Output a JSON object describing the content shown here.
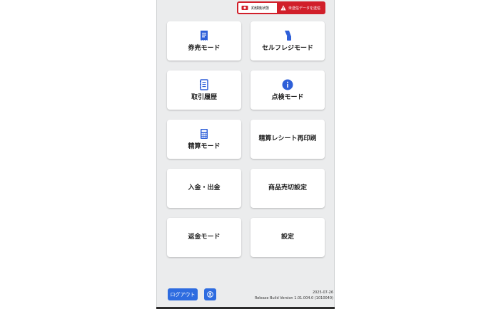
{
  "status": {
    "device_state_label": "釣銭機状態",
    "unsent_label": "未送信データを送信"
  },
  "tiles": [
    {
      "label": "券売モード",
      "icon": "ticket-icon"
    },
    {
      "label": "セルフレジモード",
      "icon": "self-register-icon"
    },
    {
      "label": "取引履歴",
      "icon": "history-icon"
    },
    {
      "label": "点検モード",
      "icon": "info-icon"
    },
    {
      "label": "精算モード",
      "icon": "calculator-icon"
    },
    {
      "label": "精算レシート再印刷",
      "icon": ""
    },
    {
      "label": "入金・出金",
      "icon": ""
    },
    {
      "label": "商品売切設定",
      "icon": ""
    },
    {
      "label": "返金モード",
      "icon": ""
    },
    {
      "label": "設定",
      "icon": ""
    }
  ],
  "footer": {
    "logout_label": "ログアウト",
    "date": "2025-07-26",
    "build": "Release Build Version 1.01.004.0 (1010040)"
  },
  "colors": {
    "accent": "#2e6ce0",
    "alert": "#d11f2a",
    "background": "#ebeced"
  }
}
